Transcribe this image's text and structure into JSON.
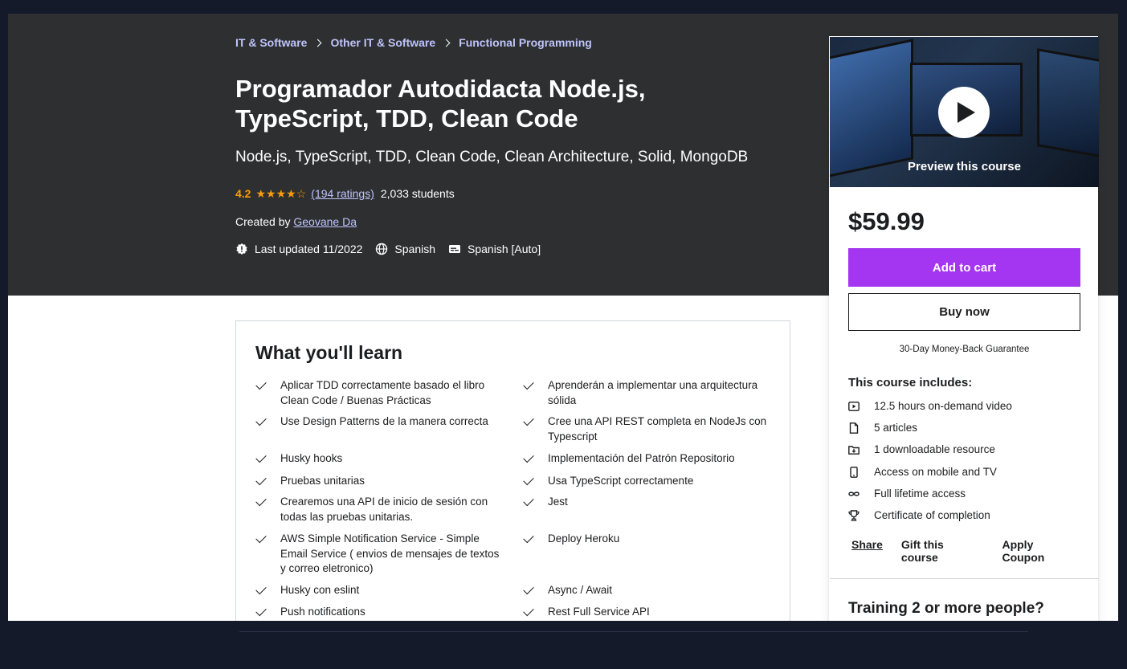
{
  "breadcrumb": [
    "IT & Software",
    "Other IT & Software",
    "Functional Programming"
  ],
  "course": {
    "title": "Programador Autodidacta Node.js, TypeScript, TDD, Clean Code",
    "subtitle": "Node.js, TypeScript, TDD, Clean Code, Clean Architecture, Solid, MongoDB",
    "rating": "4.2",
    "stars": 4.2,
    "ratings_count": "(194 ratings)",
    "students": "2,033 students",
    "created_by_label": "Created by",
    "instructor": "Geovane Da",
    "last_updated": "Last updated 11/2022",
    "language": "Spanish",
    "captions": "Spanish [Auto]"
  },
  "learn": {
    "title": "What you'll learn",
    "col1": [
      "Aplicar TDD correctamente basado el libro Clean Code / Buenas Prácticas",
      "Use Design Patterns de la manera correcta",
      "Husky hooks",
      "Pruebas unitarias",
      "Crearemos una API de inicio de sesión con todas las pruebas unitarias.",
      "AWS Simple Notification Service - Simple Email Service ( envios de mensajes de textos y correo eletronico)",
      "Husky con eslint",
      "Push notifications"
    ],
    "col2": [
      "Aprenderán a implementar una arquitectura sólida",
      "Cree una API REST completa en NodeJs con Typescript",
      "Implementación del Patrón Repositorio",
      "Usa TypeScript correctamente",
      "Jest",
      "Deploy Heroku",
      "Async / Await",
      "Rest Full Service API"
    ]
  },
  "sidebar": {
    "preview_label": "Preview this course",
    "price": "$59.99",
    "add_to_cart": "Add to cart",
    "buy_now": "Buy now",
    "guarantee": "30-Day Money-Back Guarantee",
    "includes_title": "This course includes:",
    "includes": [
      {
        "icon": "video-icon",
        "text": "12.5 hours on-demand video"
      },
      {
        "icon": "article-icon",
        "text": "5 articles"
      },
      {
        "icon": "download-icon",
        "text": "1 downloadable resource"
      },
      {
        "icon": "mobile-icon",
        "text": "Access on mobile and TV"
      },
      {
        "icon": "infinity-icon",
        "text": "Full lifetime access"
      },
      {
        "icon": "trophy-icon",
        "text": "Certificate of completion"
      }
    ],
    "share": "Share",
    "gift": "Gift this course",
    "coupon": "Apply Coupon",
    "training": "Training 2 or more people?"
  },
  "colors": {
    "hero_bg": "#2d2f31",
    "accent_purple": "#a435f0",
    "link_purple": "#c0c4fc",
    "star_orange": "#f69c08"
  }
}
